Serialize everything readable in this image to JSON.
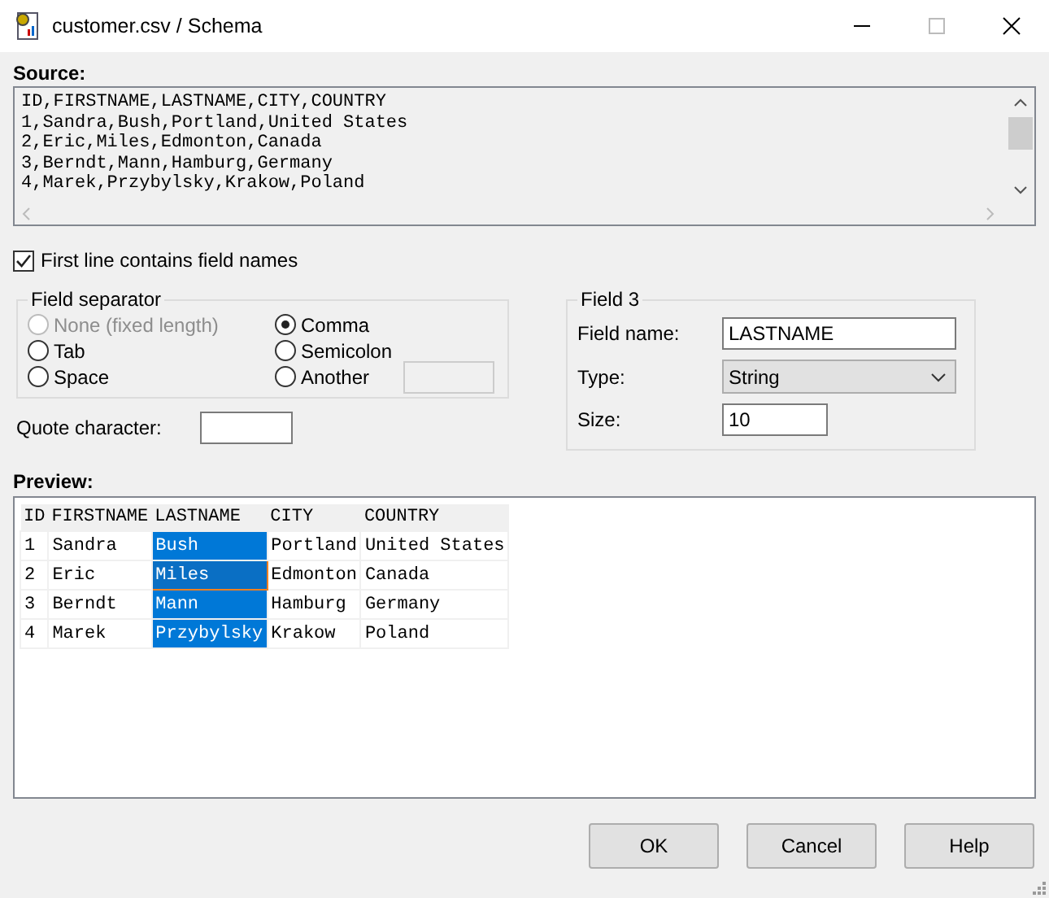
{
  "window": {
    "title": "customer.csv / Schema"
  },
  "source": {
    "label": "Source:",
    "lines": [
      "ID,FIRSTNAME,LASTNAME,CITY,COUNTRY",
      "1,Sandra,Bush,Portland,United States",
      "2,Eric,Miles,Edmonton,Canada",
      "3,Berndt,Mann,Hamburg,Germany",
      "4,Marek,Przybylsky,Krakow,Poland"
    ]
  },
  "first_line_names": {
    "label": "First line contains field names",
    "checked": true
  },
  "field_separator": {
    "title": "Field separator",
    "options": [
      {
        "label": "None (fixed length)",
        "selected": false,
        "disabled": true
      },
      {
        "label": "Comma",
        "selected": true,
        "disabled": false
      },
      {
        "label": "Tab",
        "selected": false,
        "disabled": false
      },
      {
        "label": "Semicolon",
        "selected": false,
        "disabled": false
      },
      {
        "label": "Space",
        "selected": false,
        "disabled": false
      },
      {
        "label": "Another",
        "selected": false,
        "disabled": false
      }
    ],
    "another_field": {
      "disabled": true
    }
  },
  "quote_character": {
    "label": "Quote character:"
  },
  "field": {
    "title": "Field 3",
    "name_label": "Field name:",
    "name_value": "LASTNAME",
    "type_label": "Type:",
    "type_value": "String",
    "size_label": "Size:",
    "size_value": "10"
  },
  "preview": {
    "label": "Preview:",
    "columns": [
      {
        "label": "ID",
        "selected": false
      },
      {
        "label": "FIRSTNAME",
        "selected": false
      },
      {
        "label": "LASTNAME",
        "selected": true
      },
      {
        "label": "CITY",
        "selected": false
      },
      {
        "label": "COUNTRY",
        "selected": false
      }
    ],
    "rows": [
      {
        "cells": [
          "1",
          "Sandra",
          "Bush",
          "Portland",
          "United States"
        ],
        "focused": false
      },
      {
        "cells": [
          "2",
          "Eric",
          "Miles",
          "Edmonton",
          "Canada"
        ],
        "focused": true
      },
      {
        "cells": [
          "3",
          "Berndt",
          "Mann",
          "Hamburg",
          "Germany"
        ],
        "focused": false
      },
      {
        "cells": [
          "4",
          "Marek",
          "Przybylsky",
          "Krakow",
          "Poland"
        ],
        "focused": false
      }
    ]
  },
  "buttons": [
    "OK",
    "Cancel",
    "Help"
  ]
}
